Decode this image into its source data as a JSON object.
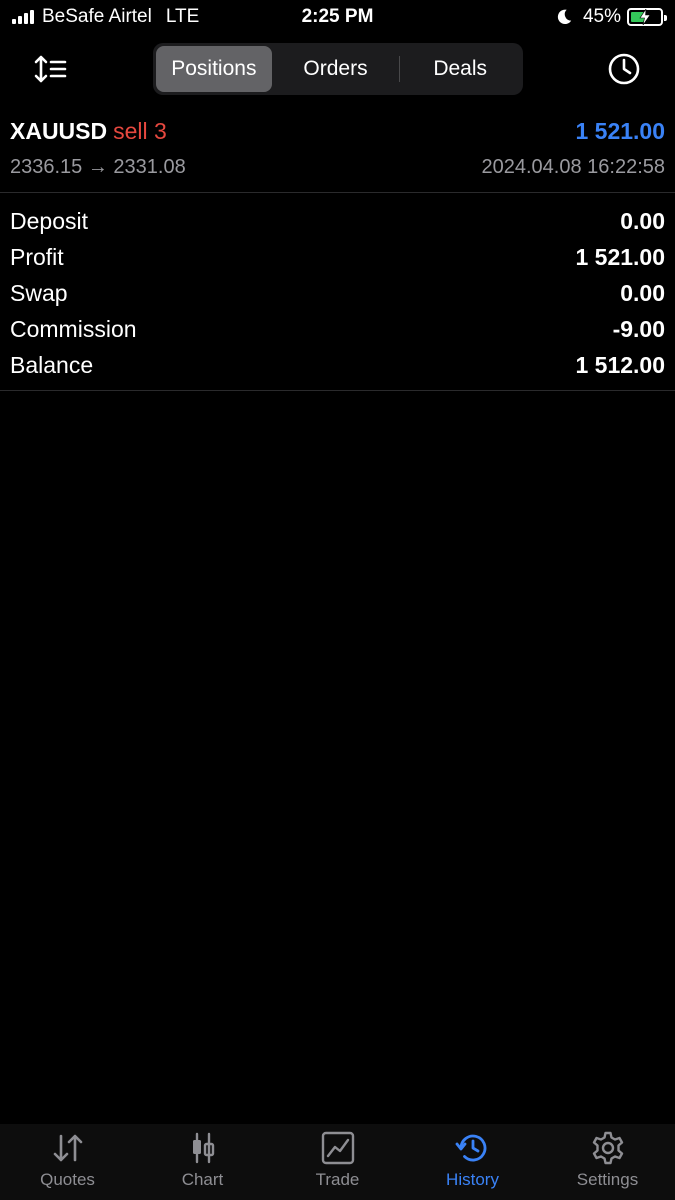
{
  "status_bar": {
    "carrier": "BeSafe Airtel",
    "network": "LTE",
    "time": "2:25 PM",
    "battery_percent": "45%",
    "battery_level": 0.45
  },
  "top_nav": {
    "tabs": [
      {
        "label": "Positions",
        "active": true
      },
      {
        "label": "Orders",
        "active": false
      },
      {
        "label": "Deals",
        "active": false
      }
    ],
    "sort_icon": "sort-icon",
    "clock_icon": "clock-icon"
  },
  "deal": {
    "symbol": "XAUUSD",
    "side": "sell 3",
    "profit": "1 521.00",
    "prices": "2336.15 → 2331.08",
    "timestamp": "2024.04.08 16:22:58"
  },
  "summary": [
    {
      "label": "Deposit",
      "value": "0.00"
    },
    {
      "label": "Profit",
      "value": "1 521.00"
    },
    {
      "label": "Swap",
      "value": "0.00"
    },
    {
      "label": "Commission",
      "value": "-9.00"
    },
    {
      "label": "Balance",
      "value": "1 512.00"
    }
  ],
  "tab_bar": [
    {
      "label": "Quotes",
      "icon": "quotes-icon",
      "active": false
    },
    {
      "label": "Chart",
      "icon": "chart-icon",
      "active": false
    },
    {
      "label": "Trade",
      "icon": "trade-icon",
      "active": false
    },
    {
      "label": "History",
      "icon": "history-icon",
      "active": true
    },
    {
      "label": "Settings",
      "icon": "settings-icon",
      "active": false
    }
  ],
  "colors": {
    "accent": "#3a82f6",
    "sell": "#e5483f",
    "battery": "#34c759"
  }
}
